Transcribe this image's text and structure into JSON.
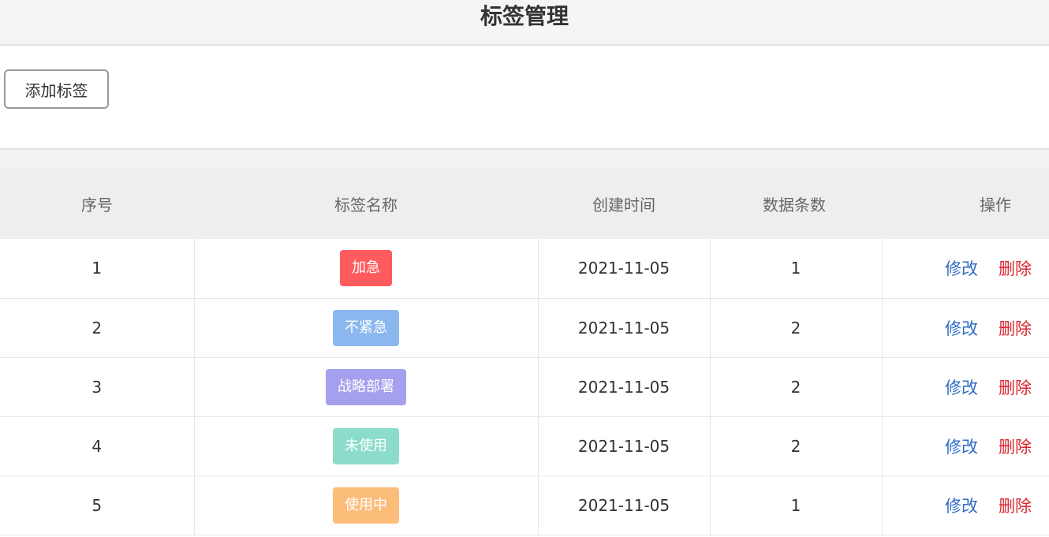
{
  "header": {
    "title": "标签管理"
  },
  "toolbar": {
    "add_label": "添加标签"
  },
  "table": {
    "columns": [
      "序号",
      "标签名称",
      "创建时间",
      "数据条数",
      "操作"
    ],
    "rows": [
      {
        "index": "1",
        "tag": "加急",
        "tag_color": "#ff5b5f",
        "created": "2021-11-05",
        "count": "1",
        "edit": "修改",
        "delete": "删除"
      },
      {
        "index": "2",
        "tag": "不紧急",
        "tag_color": "#8cb8f0",
        "created": "2021-11-05",
        "count": "2",
        "edit": "修改",
        "delete": "删除"
      },
      {
        "index": "3",
        "tag": "战略部署",
        "tag_color": "#a5a0ee",
        "created": "2021-11-05",
        "count": "2",
        "edit": "修改",
        "delete": "删除"
      },
      {
        "index": "4",
        "tag": "未使用",
        "tag_color": "#8cdcca",
        "created": "2021-11-05",
        "count": "2",
        "edit": "修改",
        "delete": "删除"
      },
      {
        "index": "5",
        "tag": "使用中",
        "tag_color": "#fdbd7a",
        "created": "2021-11-05",
        "count": "1",
        "edit": "修改",
        "delete": "删除"
      }
    ]
  }
}
